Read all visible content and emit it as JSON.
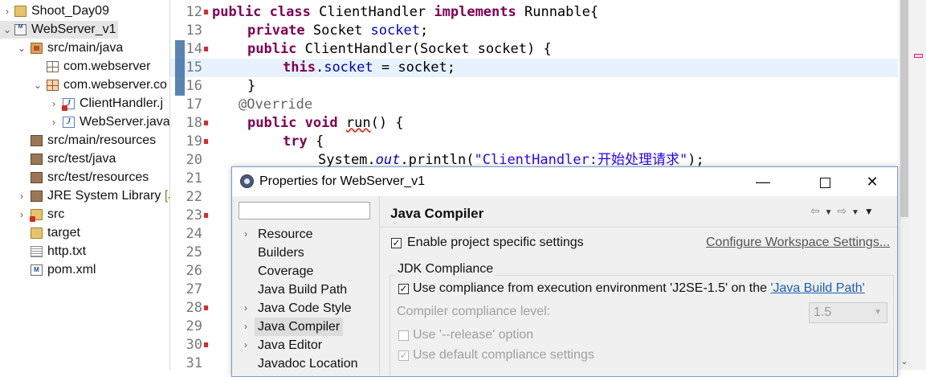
{
  "explorer": {
    "items": [
      {
        "twisty": "›",
        "label": "Shoot_Day09"
      },
      {
        "twisty": "⌄",
        "label": "WebServer_v1"
      },
      {
        "twisty": "⌄",
        "label": "src/main/java"
      },
      {
        "twisty": "",
        "label": "com.webserver"
      },
      {
        "twisty": "⌄",
        "label": "com.webserver.co"
      },
      {
        "twisty": "›",
        "label": "ClientHandler.j"
      },
      {
        "twisty": "›",
        "label": "WebServer.java"
      },
      {
        "twisty": "",
        "label": "src/main/resources"
      },
      {
        "twisty": "",
        "label": "src/test/java"
      },
      {
        "twisty": "",
        "label": "src/test/resources"
      },
      {
        "twisty": "›",
        "label": "JRE System Library",
        "suffix": "[J"
      },
      {
        "twisty": "›",
        "label": "src"
      },
      {
        "twisty": "",
        "label": "target"
      },
      {
        "twisty": "",
        "label": "http.txt"
      },
      {
        "twisty": "",
        "label": "pom.xml"
      }
    ]
  },
  "editor": {
    "line_numbers": [
      "12",
      "13",
      "14",
      "15",
      "16",
      "17",
      "18",
      "19",
      "20",
      "21",
      "22",
      "23",
      "24",
      "25",
      "26",
      "27",
      "28",
      "29",
      "30",
      "31"
    ],
    "l12": {
      "kw1": "public",
      "kw2": "class",
      "name": " ClientHandler ",
      "kw3": "implements",
      "rest": " Runnable{"
    },
    "l13": {
      "kw1": "private",
      "type": " Socket ",
      "field": "socket",
      "rest": ";"
    },
    "l14": {
      "kw1": "public",
      "rest": " ClientHandler(Socket socket) {"
    },
    "l15": {
      "kw1": "this",
      "dot": ".",
      "field": "socket",
      "rest": " = socket;"
    },
    "l16": {
      "text": "}"
    },
    "l17": {
      "text": "@Override"
    },
    "l18": {
      "kw1": "public",
      "kw2": "void",
      "method": "run",
      "rest": "() {"
    },
    "l19": {
      "kw1": "try",
      "rest": " {"
    },
    "l20": {
      "pre": "System.",
      "out": "out",
      "mid": ".println(",
      "str": "\"ClientHandler:开始处理请求\"",
      "rest": ");"
    }
  },
  "dialog": {
    "title": "Properties for WebServer_v1",
    "minimize": "—",
    "close": "✕",
    "filter_value": "",
    "nav": [
      {
        "label": "Resource",
        "expandable": true
      },
      {
        "label": "Builders",
        "expandable": false
      },
      {
        "label": "Coverage",
        "expandable": false
      },
      {
        "label": "Java Build Path",
        "expandable": false
      },
      {
        "label": "Java Code Style",
        "expandable": true
      },
      {
        "label": "Java Compiler",
        "expandable": true,
        "selected": true
      },
      {
        "label": "Java Editor",
        "expandable": true
      },
      {
        "label": "Javadoc Location",
        "expandable": false
      }
    ],
    "page_title": "Java Compiler",
    "enable_specific": "Enable project specific settings",
    "configure_link": "Configure Workspace Settings...",
    "group_title": "JDK Compliance",
    "use_compliance_prefix": "Use compliance from execution environment 'J2SE-1.5' on the ",
    "build_path_link": "'Java Build Path'",
    "compliance_level_label": "Compiler compliance level:",
    "compliance_level_value": "1.5",
    "release_option": "Use '--release' option",
    "default_compliance": "Use default compliance settings",
    "checkbox_states": {
      "enable_specific": true,
      "use_compliance": true,
      "release": false,
      "default_compliance": true
    }
  }
}
